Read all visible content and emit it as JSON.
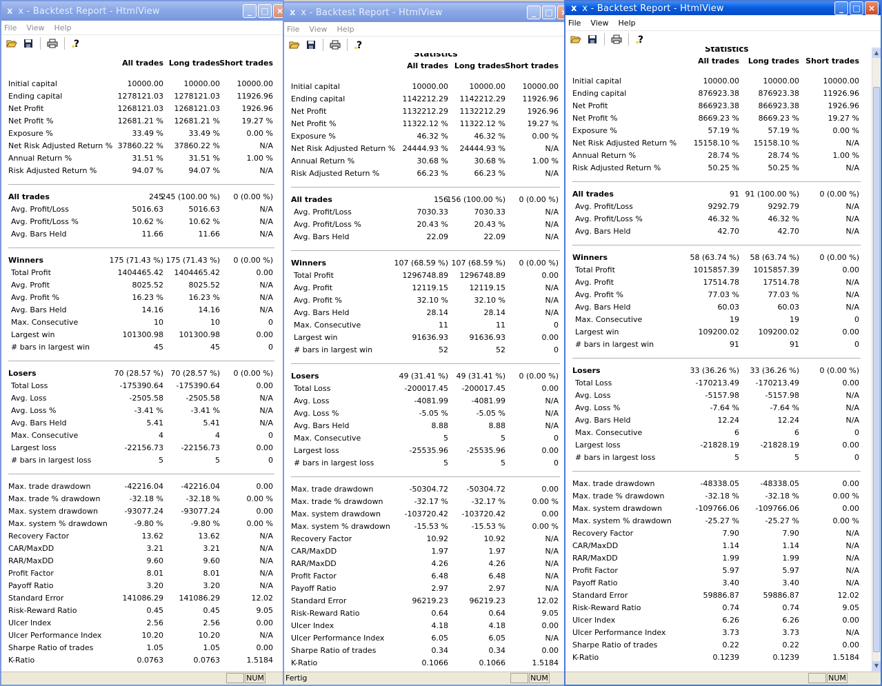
{
  "app": {
    "title": "x - Backtest Report - HtmlView",
    "menu": [
      "File",
      "View",
      "Help"
    ],
    "status_num": "NUM",
    "status_ready": "Fertig",
    "stats_title": "Statistics",
    "columns": [
      "All trades",
      "Long trades",
      "Short trades"
    ]
  },
  "icons": [
    "open-folder-icon",
    "save-disk-icon",
    "print-icon",
    "help-icon"
  ],
  "colors": {
    "title_active": "#0a5ddf",
    "title_inactive": "#8aa8e6",
    "window_border": "#4a77d6"
  },
  "labels": [
    [
      "Initial capital",
      "Ending capital",
      "Net Profit",
      "Net Profit %",
      "Exposure %",
      "Net Risk Adjusted Return %",
      "Annual Return %",
      "Risk Adjusted Return %"
    ],
    [
      "All trades",
      "Avg. Profit/Loss",
      "Avg. Profit/Loss %",
      "Avg. Bars Held"
    ],
    [
      "Winners",
      "Total Profit",
      "Avg. Profit",
      "Avg. Profit %",
      "Avg. Bars Held",
      "Max. Consecutive",
      "Largest win",
      "# bars in largest win"
    ],
    [
      "Losers",
      "Total Loss",
      "Avg. Loss",
      "Avg. Loss %",
      "Avg. Bars Held",
      "Max. Consecutive",
      "Largest loss",
      "# bars in largest loss"
    ],
    [
      "Max. trade drawdown",
      "Max. trade % drawdown",
      "Max. system drawdown",
      "Max. system % drawdown",
      "Recovery Factor",
      "CAR/MaxDD",
      "RAR/MaxDD",
      "Profit Factor",
      "Payoff Ratio",
      "Standard Error",
      "Risk-Reward Ratio",
      "Ulcer Index",
      "Ulcer Performance Index",
      "Sharpe Ratio of trades",
      "K-Ratio"
    ]
  ],
  "windows": [
    {
      "values": [
        [
          [
            "10000.00",
            "10000.00",
            "10000.00"
          ],
          [
            "1278121.03",
            "1278121.03",
            "11926.96"
          ],
          [
            "1268121.03",
            "1268121.03",
            "1926.96"
          ],
          [
            "12681.21 %",
            "12681.21 %",
            "19.27 %"
          ],
          [
            "33.49 %",
            "33.49 %",
            "0.00 %"
          ],
          [
            "37860.22 %",
            "37860.22 %",
            "N/A"
          ],
          [
            "31.51 %",
            "31.51 %",
            "1.00 %"
          ],
          [
            "94.07 %",
            "94.07 %",
            "N/A"
          ]
        ],
        [
          [
            "245",
            "245 (100.00 %)",
            "0 (0.00 %)"
          ],
          [
            "5016.63",
            "5016.63",
            "N/A"
          ],
          [
            "10.62 %",
            "10.62 %",
            "N/A"
          ],
          [
            "11.66",
            "11.66",
            "N/A"
          ]
        ],
        [
          [
            "175 (71.43 %)",
            "175 (71.43 %)",
            "0 (0.00 %)"
          ],
          [
            "1404465.42",
            "1404465.42",
            "0.00"
          ],
          [
            "8025.52",
            "8025.52",
            "N/A"
          ],
          [
            "16.23 %",
            "16.23 %",
            "N/A"
          ],
          [
            "14.16",
            "14.16",
            "N/A"
          ],
          [
            "10",
            "10",
            "0"
          ],
          [
            "101300.98",
            "101300.98",
            "0.00"
          ],
          [
            "45",
            "45",
            "0"
          ]
        ],
        [
          [
            "70 (28.57 %)",
            "70 (28.57 %)",
            "0 (0.00 %)"
          ],
          [
            "-175390.64",
            "-175390.64",
            "0.00"
          ],
          [
            "-2505.58",
            "-2505.58",
            "N/A"
          ],
          [
            "-3.41 %",
            "-3.41 %",
            "N/A"
          ],
          [
            "5.41",
            "5.41",
            "N/A"
          ],
          [
            "4",
            "4",
            "0"
          ],
          [
            "-22156.73",
            "-22156.73",
            "0.00"
          ],
          [
            "5",
            "5",
            "0"
          ]
        ],
        [
          [
            "-42216.04",
            "-42216.04",
            "0.00"
          ],
          [
            "-32.18 %",
            "-32.18 %",
            "0.00 %"
          ],
          [
            "-93077.24",
            "-93077.24",
            "0.00"
          ],
          [
            "-9.80 %",
            "-9.80 %",
            "0.00 %"
          ],
          [
            "13.62",
            "13.62",
            "N/A"
          ],
          [
            "3.21",
            "3.21",
            "N/A"
          ],
          [
            "9.60",
            "9.60",
            "N/A"
          ],
          [
            "8.01",
            "8.01",
            "N/A"
          ],
          [
            "3.20",
            "3.20",
            "N/A"
          ],
          [
            "141086.29",
            "141086.29",
            "12.02"
          ],
          [
            "0.45",
            "0.45",
            "9.05"
          ],
          [
            "2.56",
            "2.56",
            "0.00"
          ],
          [
            "10.20",
            "10.20",
            "N/A"
          ],
          [
            "1.05",
            "1.05",
            "0.00"
          ],
          [
            "0.0763",
            "0.0763",
            "1.5184"
          ]
        ]
      ]
    },
    {
      "values": [
        [
          [
            "10000.00",
            "10000.00",
            "10000.00"
          ],
          [
            "1142212.29",
            "1142212.29",
            "11926.96"
          ],
          [
            "1132212.29",
            "1132212.29",
            "1926.96"
          ],
          [
            "11322.12 %",
            "11322.12 %",
            "19.27 %"
          ],
          [
            "46.32 %",
            "46.32 %",
            "0.00 %"
          ],
          [
            "24444.93 %",
            "24444.93 %",
            "N/A"
          ],
          [
            "30.68 %",
            "30.68 %",
            "1.00 %"
          ],
          [
            "66.23 %",
            "66.23 %",
            "N/A"
          ]
        ],
        [
          [
            "156",
            "156 (100.00 %)",
            "0 (0.00 %)"
          ],
          [
            "7030.33",
            "7030.33",
            "N/A"
          ],
          [
            "20.43 %",
            "20.43 %",
            "N/A"
          ],
          [
            "22.09",
            "22.09",
            "N/A"
          ]
        ],
        [
          [
            "107 (68.59 %)",
            "107 (68.59 %)",
            "0 (0.00 %)"
          ],
          [
            "1296748.89",
            "1296748.89",
            "0.00"
          ],
          [
            "12119.15",
            "12119.15",
            "N/A"
          ],
          [
            "32.10 %",
            "32.10 %",
            "N/A"
          ],
          [
            "28.14",
            "28.14",
            "N/A"
          ],
          [
            "11",
            "11",
            "0"
          ],
          [
            "91636.93",
            "91636.93",
            "0.00"
          ],
          [
            "52",
            "52",
            "0"
          ]
        ],
        [
          [
            "49 (31.41 %)",
            "49 (31.41 %)",
            "0 (0.00 %)"
          ],
          [
            "-200017.45",
            "-200017.45",
            "0.00"
          ],
          [
            "-4081.99",
            "-4081.99",
            "N/A"
          ],
          [
            "-5.05 %",
            "-5.05 %",
            "N/A"
          ],
          [
            "8.88",
            "8.88",
            "N/A"
          ],
          [
            "5",
            "5",
            "0"
          ],
          [
            "-25535.96",
            "-25535.96",
            "0.00"
          ],
          [
            "5",
            "5",
            "0"
          ]
        ],
        [
          [
            "-50304.72",
            "-50304.72",
            "0.00"
          ],
          [
            "-32.17 %",
            "-32.17 %",
            "0.00 %"
          ],
          [
            "-103720.42",
            "-103720.42",
            "0.00"
          ],
          [
            "-15.53 %",
            "-15.53 %",
            "0.00 %"
          ],
          [
            "10.92",
            "10.92",
            "N/A"
          ],
          [
            "1.97",
            "1.97",
            "N/A"
          ],
          [
            "4.26",
            "4.26",
            "N/A"
          ],
          [
            "6.48",
            "6.48",
            "N/A"
          ],
          [
            "2.97",
            "2.97",
            "N/A"
          ],
          [
            "96219.23",
            "96219.23",
            "12.02"
          ],
          [
            "0.64",
            "0.64",
            "9.05"
          ],
          [
            "4.18",
            "4.18",
            "0.00"
          ],
          [
            "6.05",
            "6.05",
            "N/A"
          ],
          [
            "0.34",
            "0.34",
            "0.00"
          ],
          [
            "0.1066",
            "0.1066",
            "1.5184"
          ]
        ]
      ]
    },
    {
      "values": [
        [
          [
            "10000.00",
            "10000.00",
            "10000.00"
          ],
          [
            "876923.38",
            "876923.38",
            "11926.96"
          ],
          [
            "866923.38",
            "866923.38",
            "1926.96"
          ],
          [
            "8669.23 %",
            "8669.23 %",
            "19.27 %"
          ],
          [
            "57.19 %",
            "57.19 %",
            "0.00 %"
          ],
          [
            "15158.10 %",
            "15158.10 %",
            "N/A"
          ],
          [
            "28.74 %",
            "28.74 %",
            "1.00 %"
          ],
          [
            "50.25 %",
            "50.25 %",
            "N/A"
          ]
        ],
        [
          [
            "91",
            "91 (100.00 %)",
            "0 (0.00 %)"
          ],
          [
            "9292.79",
            "9292.79",
            "N/A"
          ],
          [
            "46.32 %",
            "46.32 %",
            "N/A"
          ],
          [
            "42.70",
            "42.70",
            "N/A"
          ]
        ],
        [
          [
            "58 (63.74 %)",
            "58 (63.74 %)",
            "0 (0.00 %)"
          ],
          [
            "1015857.39",
            "1015857.39",
            "0.00"
          ],
          [
            "17514.78",
            "17514.78",
            "N/A"
          ],
          [
            "77.03 %",
            "77.03 %",
            "N/A"
          ],
          [
            "60.03",
            "60.03",
            "N/A"
          ],
          [
            "19",
            "19",
            "0"
          ],
          [
            "109200.02",
            "109200.02",
            "0.00"
          ],
          [
            "91",
            "91",
            "0"
          ]
        ],
        [
          [
            "33 (36.26 %)",
            "33 (36.26 %)",
            "0 (0.00 %)"
          ],
          [
            "-170213.49",
            "-170213.49",
            "0.00"
          ],
          [
            "-5157.98",
            "-5157.98",
            "N/A"
          ],
          [
            "-7.64 %",
            "-7.64 %",
            "N/A"
          ],
          [
            "12.24",
            "12.24",
            "N/A"
          ],
          [
            "6",
            "6",
            "0"
          ],
          [
            "-21828.19",
            "-21828.19",
            "0.00"
          ],
          [
            "5",
            "5",
            "0"
          ]
        ],
        [
          [
            "-48338.05",
            "-48338.05",
            "0.00"
          ],
          [
            "-32.18 %",
            "-32.18 %",
            "0.00 %"
          ],
          [
            "-109766.06",
            "-109766.06",
            "0.00"
          ],
          [
            "-25.27 %",
            "-25.27 %",
            "0.00 %"
          ],
          [
            "7.90",
            "7.90",
            "N/A"
          ],
          [
            "1.14",
            "1.14",
            "N/A"
          ],
          [
            "1.99",
            "1.99",
            "N/A"
          ],
          [
            "5.97",
            "5.97",
            "N/A"
          ],
          [
            "3.40",
            "3.40",
            "N/A"
          ],
          [
            "59886.87",
            "59886.87",
            "12.02"
          ],
          [
            "0.74",
            "0.74",
            "9.05"
          ],
          [
            "6.26",
            "6.26",
            "0.00"
          ],
          [
            "3.73",
            "3.73",
            "N/A"
          ],
          [
            "0.22",
            "0.22",
            "0.00"
          ],
          [
            "0.1239",
            "0.1239",
            "1.5184"
          ]
        ]
      ]
    }
  ]
}
